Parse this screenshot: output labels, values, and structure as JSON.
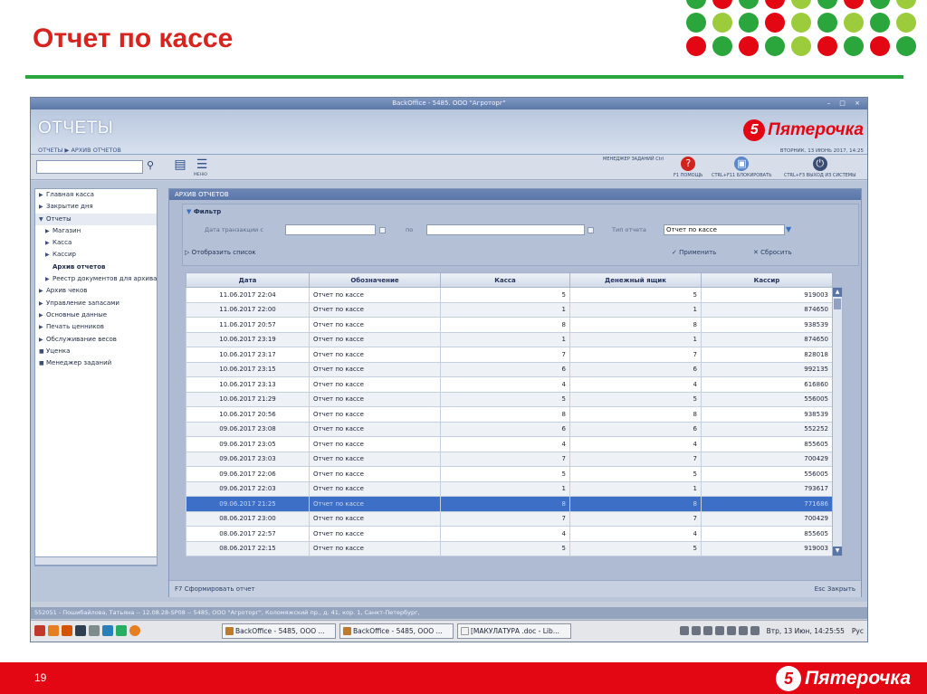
{
  "slide": {
    "title": "Отчет по кассе",
    "number": "19",
    "logo_letter": "5",
    "logo_text": "Пятерочка"
  },
  "colors": {
    "red": "#e30613",
    "green": "#2aa63c",
    "lime": "#9ccc3c",
    "selection": "#3d6fc7"
  },
  "window": {
    "title": "BackOffice - 5485. ООО \"Агроторг\"",
    "app_title": "ОТЧЕТЫ",
    "breadcrumb": "ОТЧЕТЫ ▶ АРХИВ ОТЧЕТОВ",
    "brand_letter": "5",
    "brand_text": "Пятерочка",
    "date": "ВТОРНИК, 13 ИЮНЬ 2017, 14:25",
    "search_value": "",
    "toolbar": {
      "menu_label": "МЕНЮ",
      "task_manager": "МЕНЕДЖЕР ЗАДАНИЙ Ctrl",
      "help": "F1 ПОМОЩЬ",
      "lock": "CTRL+F11 БЛОКИРОВАТЬ",
      "exit": "CTRL+F3 ВЫХОД ИЗ СИСТЕМЫ"
    }
  },
  "sidebar": {
    "items": [
      {
        "label": "Главная касса",
        "marker": "▶",
        "level": 0
      },
      {
        "label": "Закрытие дня",
        "marker": "▶",
        "level": 0
      },
      {
        "label": "Отчеты",
        "marker": "▼",
        "level": 0
      },
      {
        "label": "Магазин",
        "marker": "▶",
        "level": 1
      },
      {
        "label": "Касса",
        "marker": "▶",
        "level": 1
      },
      {
        "label": "Кассир",
        "marker": "▶",
        "level": 1
      },
      {
        "label": "Архив отчетов",
        "marker": "",
        "level": 1
      },
      {
        "label": "Реестр документов для архива",
        "marker": "▶",
        "level": 1
      },
      {
        "label": "Архив чеков",
        "marker": "▶",
        "level": 0
      },
      {
        "label": "Управление запасами",
        "marker": "▶",
        "level": 0
      },
      {
        "label": "Основные данные",
        "marker": "▶",
        "level": 0
      },
      {
        "label": "Печать ценников",
        "marker": "▶",
        "level": 0
      },
      {
        "label": "Обслуживание весов",
        "marker": "▶",
        "level": 0
      },
      {
        "label": "Уценка",
        "marker": "■",
        "level": 0
      },
      {
        "label": "Менеджер заданий",
        "marker": "■",
        "level": 0
      }
    ]
  },
  "panel": {
    "title": "АРХИВ ОТЧЕТОВ",
    "filter_title": "Фильтр",
    "date_from_label": "Дата транзакции с",
    "date_to_label": "по",
    "date_from": "",
    "date_to": "",
    "type_label": "Тип отчета",
    "type_value": "Отчет по кассе",
    "show_list": "Отобразить список",
    "apply": "Применить",
    "reset": "Сбросить",
    "bottom_left": "F7  Сформировать отчет",
    "bottom_right": "Esc  Закрыть"
  },
  "table": {
    "headers": [
      "Дата",
      "Обозначение",
      "Касса",
      "Денежный ящик",
      "Кассир"
    ],
    "selected_index": 14,
    "rows": [
      [
        "11.06.2017 22:04",
        "Отчет по кассе",
        "5",
        "5",
        "919003"
      ],
      [
        "11.06.2017 22:00",
        "Отчет по кассе",
        "1",
        "1",
        "874650"
      ],
      [
        "11.06.2017 20:57",
        "Отчет по кассе",
        "8",
        "8",
        "938539"
      ],
      [
        "10.06.2017 23:19",
        "Отчет по кассе",
        "1",
        "1",
        "874650"
      ],
      [
        "10.06.2017 23:17",
        "Отчет по кассе",
        "7",
        "7",
        "828018"
      ],
      [
        "10.06.2017 23:15",
        "Отчет по кассе",
        "6",
        "6",
        "992135"
      ],
      [
        "10.06.2017 23:13",
        "Отчет по кассе",
        "4",
        "4",
        "616860"
      ],
      [
        "10.06.2017 21:29",
        "Отчет по кассе",
        "5",
        "5",
        "556005"
      ],
      [
        "10.06.2017 20:56",
        "Отчет по кассе",
        "8",
        "8",
        "938539"
      ],
      [
        "09.06.2017 23:08",
        "Отчет по кассе",
        "6",
        "6",
        "552252"
      ],
      [
        "09.06.2017 23:05",
        "Отчет по кассе",
        "4",
        "4",
        "855605"
      ],
      [
        "09.06.2017 23:03",
        "Отчет по кассе",
        "7",
        "7",
        "700429"
      ],
      [
        "09.06.2017 22:06",
        "Отчет по кассе",
        "5",
        "5",
        "556005"
      ],
      [
        "09.06.2017 22:03",
        "Отчет по кассе",
        "1",
        "1",
        "793617"
      ],
      [
        "09.06.2017 21:25",
        "Отчет по кассе",
        "8",
        "8",
        "771686"
      ],
      [
        "08.06.2017 23:00",
        "Отчет по кассе",
        "7",
        "7",
        "700429"
      ],
      [
        "08.06.2017 22:57",
        "Отчет по кассе",
        "4",
        "4",
        "855605"
      ],
      [
        "08.06.2017 22:15",
        "Отчет по кассе",
        "5",
        "5",
        "919003"
      ]
    ]
  },
  "statusbar": "552051 - Пошибайлова, Татьяна -- 12.08.28-SP08 -- 5485, ООО \"Агроторг\", Коломяжский пр., д. 41, кор. 1, Санкт-Петербург,",
  "taskbar": {
    "tasks": [
      "BackOffice - 5485, ООО ...",
      "BackOffice - 5485, ООО ...",
      "[МАКУЛАТУРА .doc - Lib..."
    ],
    "clock": "Втр, 13 Июн, 14:25:55",
    "lang": "Рус"
  }
}
